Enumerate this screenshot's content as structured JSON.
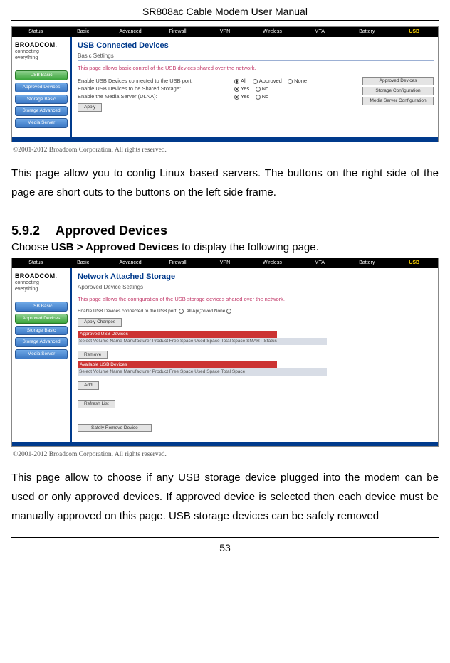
{
  "doc": {
    "header": "SR808ac Cable Modem User Manual",
    "page_number": "53"
  },
  "nav": {
    "items": [
      "Status",
      "Basic",
      "Advanced",
      "Firewall",
      "VPN",
      "Wireless",
      "MTA",
      "Battery",
      "USB"
    ]
  },
  "logo": {
    "brand": "BROADCOM.",
    "tag1": "connecting",
    "tag2": "everything"
  },
  "sidebar": {
    "items": [
      "USB Basic",
      "Approved Devices",
      "Storage Basic",
      "Storage Advanced",
      "Media Server"
    ]
  },
  "shot1": {
    "title": "USB Connected Devices",
    "subtitle": "Basic Settings",
    "desc": "This page allows basic control of the USB devices shared over the network.",
    "rows": [
      {
        "label": "Enable USB Devices connected to the USB port:",
        "optA": "All",
        "optB": "Approved",
        "optC": "None"
      },
      {
        "label": "Enable USB Devices to be Shared Storage:",
        "optA": "Yes",
        "optB": "No"
      },
      {
        "label": "Enable the Media Server (DLNA):",
        "optA": "Yes",
        "optB": "No"
      }
    ],
    "apply": "Apply",
    "rightButtons": [
      "Approved Devices",
      "Storage Configuration",
      "Media Server Configuration"
    ]
  },
  "copyright": "©2001-2012 Broadcom Corporation. All rights reserved.",
  "para1": "This page allow you to config Linux based servers. The buttons on the right side of the page are short cuts to the buttons on the left side frame.",
  "section": {
    "num": "5.9.2",
    "title": "Approved Devices",
    "lead_a": "Choose ",
    "lead_b": "USB > Approved Devices",
    "lead_c": " to display the following page."
  },
  "shot2": {
    "title": "Network Attached Storage",
    "subtitle": "Approved Device Settings",
    "desc": "This page allows the configuration of the USB storage devices shared over the network.",
    "row1_label": "Enable USB Devices connected to the USB port:",
    "row1_opts": "All ApÇroved None",
    "apply": "Apply Changes",
    "strip1": "Approved USB Devices",
    "hdr1": "Select  Volume Name  Manufacturer  Product  Free Space  Used Space  Total Space  SMART Status",
    "remove": "Remove",
    "strip2": "Available USB Devices",
    "hdr2": "Select  Volume Name  Manufacturer  Product  Free Space  Used Space  Total Space",
    "add": "Add",
    "refresh": "Refresh List",
    "safe": "Safely Remove Device"
  },
  "para2": "This page allow to choose if any USB storage device plugged into the modem can be used or only approved devices. If approved device is selected then each device must be manually approved on this page. USB storage devices can be safely removed"
}
